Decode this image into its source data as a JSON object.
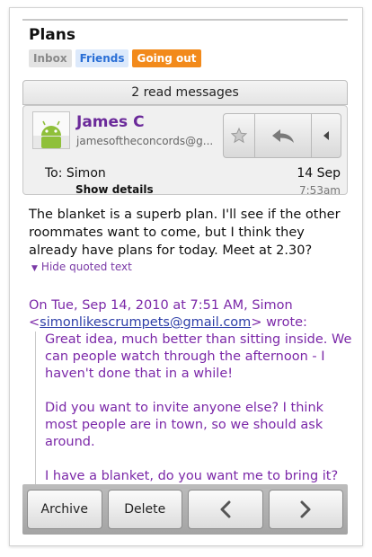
{
  "conversation": {
    "subject": "Plans",
    "labels": [
      {
        "name": "Inbox"
      },
      {
        "name": "Friends"
      },
      {
        "name": "Going out"
      }
    ],
    "read_messages_label": "2 read messages"
  },
  "message": {
    "sender_name": "James C",
    "sender_email": "jamesoftheconcords@g...",
    "to_line": "To: Simon",
    "show_details": "Show details",
    "date": "14 Sep",
    "time": "7:53am",
    "body": "The blanket is a superb plan. I'll see if the other roommates want to come, but I think they already have plans for today. Meet at 2.30?",
    "hide_quoted": "Hide quoted text",
    "quote_attribution_prefix": "On Tue, Sep 14, 2010 at 7:51 AM, Simon <",
    "quote_attribution_email": "simonlikescrumpets@gmail.com",
    "quote_attribution_suffix": "> wrote:",
    "quoted_paragraphs": [
      "Great idea, much better than sitting inside. We can people watch through the afternoon - I haven't done that in a while!",
      "Did you want to invite anyone else? I think most people are in town, so we should ask around.",
      "I have a blanket, do you want me to bring it?"
    ]
  },
  "actions": {
    "star_icon": "star-icon",
    "reply_icon": "reply-icon",
    "more_icon": "triangle-left-icon"
  },
  "bottom_bar": {
    "archive": "Archive",
    "delete": "Delete",
    "prev_icon": "chevron-left-icon",
    "next_icon": "chevron-right-icon"
  },
  "colors": {
    "sender": "#6b2a9a",
    "quoted": "#7b28a8",
    "going_out_label": "#f28a1b",
    "friends_label_text": "#2a6fd6"
  }
}
